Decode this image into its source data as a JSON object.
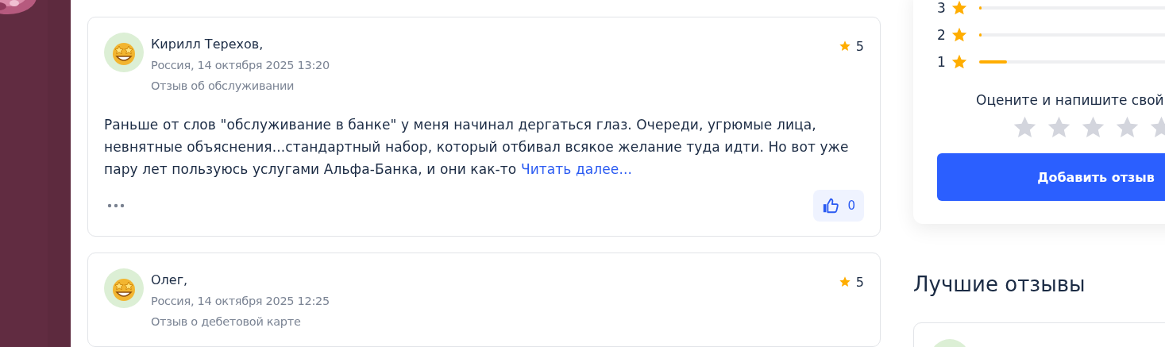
{
  "reviews": [
    {
      "name": "Кирилл Терехов,",
      "meta": "Россия, 14 октября 2025 13:20",
      "category": "Отзыв об обслуживании",
      "rating": "5",
      "text": "Раньше от слов \"обслуживание в банке\" у меня начинал дергаться глаз. Очереди, угрюмые лица, невнятные объяснения...стандартный набор, который отбивал всякое желание туда идти. Но вот уже пару лет пользуюсь услугами Альфа-Банка, и они как-то",
      "read_more": "Читать далее...",
      "likes": "0"
    },
    {
      "name": "Олег,",
      "meta": "Россия, 14 октября 2025 12:25",
      "category": "Отзыв о дебетовой карте",
      "rating": "5"
    }
  ],
  "rating_breakdown": [
    {
      "label": "3",
      "level": 0.01
    },
    {
      "label": "2",
      "level": 0.01
    },
    {
      "label": "1",
      "level": 0.1
    }
  ],
  "rate_prompt": "Оцените и напишите свой",
  "rate_stars": {
    "stars": 0
  },
  "add_button": "Добавить отзыв",
  "best_title": "Лучшие отзывы",
  "best_reviews": [
    {
      "kind": "review"
    }
  ]
}
